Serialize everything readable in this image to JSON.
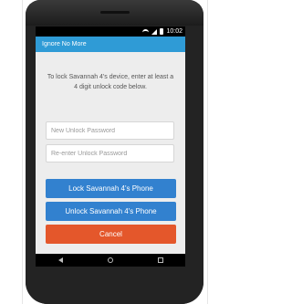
{
  "status_bar": {
    "time": "10:02",
    "icons": [
      "wifi-icon",
      "signal-icon",
      "battery-icon"
    ]
  },
  "app": {
    "title": "Ignore No More"
  },
  "main": {
    "instructions": "To lock Savannah 4's device, enter at least a 4 digit unlock code below.",
    "password_placeholder": "New Unlock Password",
    "confirm_placeholder": "Re-enter Unlock Password",
    "lock_label": "Lock Savannah 4's Phone",
    "unlock_label": "Unlock Savannah 4's Phone",
    "cancel_label": "Cancel"
  },
  "colors": {
    "title_bar": "#2f9bd6",
    "primary_button": "#3281cf",
    "cancel_button": "#e4572b"
  }
}
